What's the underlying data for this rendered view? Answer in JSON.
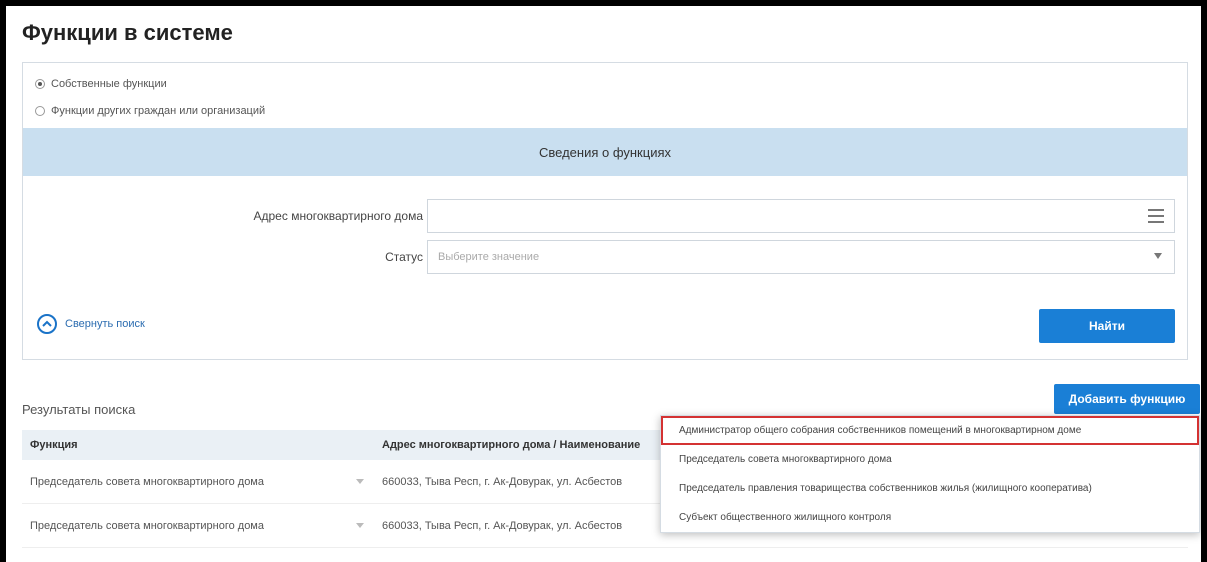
{
  "page": {
    "title": "Функции в системе"
  },
  "filters": {
    "radio_own": "Собственные функции",
    "radio_other": "Функции других граждан или организаций",
    "section_title": "Сведения о функциях",
    "address_label": "Адрес многоквартирного дома",
    "address_value": "",
    "status_label": "Статус",
    "status_placeholder": "Выберите значение",
    "collapse_label": "Свернуть поиск",
    "find_button": "Найти"
  },
  "results": {
    "title": "Результаты поиска",
    "add_button": "Добавить функцию",
    "columns": [
      "Функция",
      "Адрес многоквартирного дома / Наименование"
    ],
    "rows": [
      {
        "function": "Председатель совета многоквартирного дома",
        "address": "660033, Тыва Респ, г. Ак-Довурак, ул. Асбестов"
      },
      {
        "function": "Председатель совета многоквартирного дома",
        "address": "660033, Тыва Респ, г. Ак-Довурак, ул. Асбестов"
      }
    ]
  },
  "dropdown": {
    "items": [
      "Администратор общего собрания собственников помещений в многоквартирном доме",
      "Председатель совета многоквартирного дома",
      "Председатель правления товарищества собственников жилья (жилищного кооператива)",
      "Субъект общественного жилищного контроля"
    ]
  },
  "colors": {
    "accent": "#1a7fd6",
    "section_bg": "#c9dff0",
    "highlight": "#d43232"
  },
  "icons": [
    "radio-selected-icon",
    "radio-icon",
    "list-menu-icon",
    "chevron-down-icon",
    "collapse-up-icon"
  ]
}
